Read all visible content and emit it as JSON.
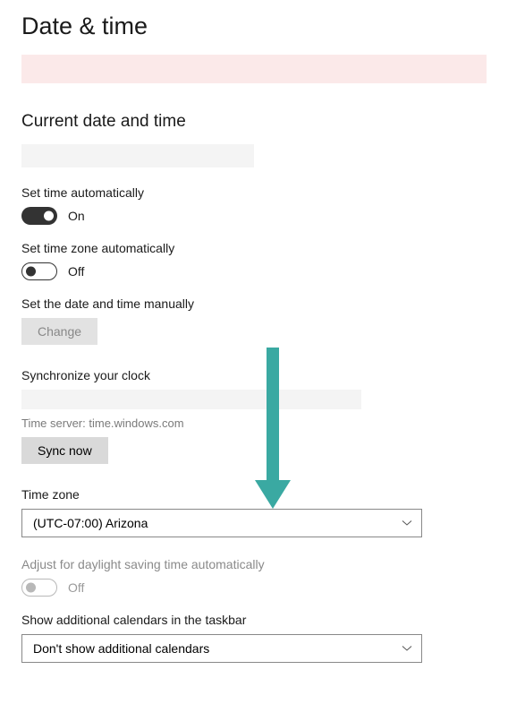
{
  "page": {
    "title": "Date & time",
    "subtitle": "Current date and time"
  },
  "settings": {
    "autoTime": {
      "label": "Set time automatically",
      "state": "On"
    },
    "autoZone": {
      "label": "Set time zone automatically",
      "state": "Off"
    },
    "manual": {
      "label": "Set the date and time manually",
      "button": "Change"
    },
    "sync": {
      "label": "Synchronize your clock",
      "server": "Time server: time.windows.com",
      "button": "Sync now"
    },
    "zone": {
      "label": "Time zone",
      "value": "(UTC-07:00) Arizona"
    },
    "dst": {
      "label": "Adjust for daylight saving time automatically",
      "state": "Off"
    },
    "calendars": {
      "label": "Show additional calendars in the taskbar",
      "value": "Don't show additional calendars"
    }
  }
}
